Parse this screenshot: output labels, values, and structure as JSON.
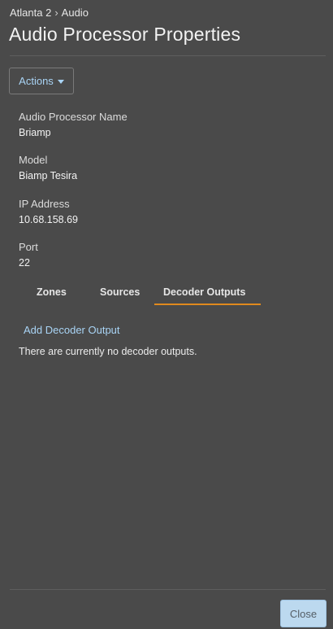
{
  "breadcrumb": {
    "parent": "Atlanta 2",
    "separator": "›",
    "current": "Audio"
  },
  "page_title": "Audio Processor Properties",
  "actions": {
    "label": "Actions",
    "icon": "caret-down-icon"
  },
  "fields": [
    {
      "label": "Audio Processor Name",
      "value": "Briamp"
    },
    {
      "label": "Model",
      "value": "Biamp Tesira"
    },
    {
      "label": "IP Address",
      "value": "10.68.158.69"
    },
    {
      "label": "Port",
      "value": "22"
    }
  ],
  "tabs": [
    {
      "label": "Zones",
      "active": false
    },
    {
      "label": "Sources",
      "active": false
    },
    {
      "label": "Decoder Outputs",
      "active": true
    }
  ],
  "decoder_outputs": {
    "add_label": "Add Decoder Output",
    "empty_message": "There are currently no decoder outputs."
  },
  "footer": {
    "close_label": "Close"
  },
  "colors": {
    "background": "#4a4a4a",
    "link": "#a9d4f5",
    "active_tab_underline": "#e08a1e",
    "close_button_bg": "#bcd9ef"
  }
}
